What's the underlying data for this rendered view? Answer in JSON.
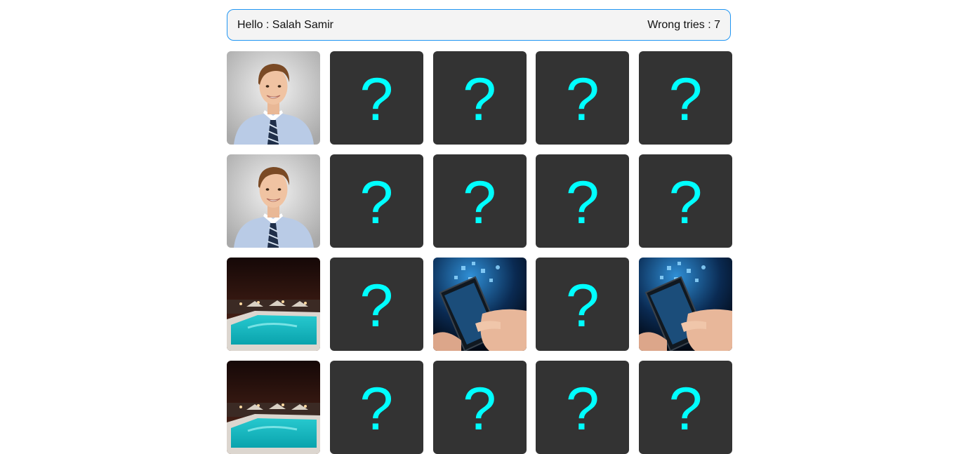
{
  "header": {
    "greeting": "Hello : Salah Samir",
    "wrong_tries": "Wrong tries : 7"
  },
  "colors": {
    "border_accent": "#2196f3",
    "card_back": "#333333",
    "question_mark": "#00ffff"
  },
  "cards": [
    {
      "state": "flipped",
      "image": "man-portrait"
    },
    {
      "state": "hidden",
      "symbol": "?"
    },
    {
      "state": "hidden",
      "symbol": "?"
    },
    {
      "state": "hidden",
      "symbol": "?"
    },
    {
      "state": "hidden",
      "symbol": "?"
    },
    {
      "state": "flipped",
      "image": "man-portrait"
    },
    {
      "state": "hidden",
      "symbol": "?"
    },
    {
      "state": "hidden",
      "symbol": "?"
    },
    {
      "state": "hidden",
      "symbol": "?"
    },
    {
      "state": "hidden",
      "symbol": "?"
    },
    {
      "state": "flipped",
      "image": "pool-night"
    },
    {
      "state": "hidden",
      "symbol": "?"
    },
    {
      "state": "flipped",
      "image": "smartphone-hands"
    },
    {
      "state": "hidden",
      "symbol": "?"
    },
    {
      "state": "flipped",
      "image": "smartphone-hands"
    },
    {
      "state": "flipped",
      "image": "pool-night"
    },
    {
      "state": "hidden",
      "symbol": "?"
    },
    {
      "state": "hidden",
      "symbol": "?"
    },
    {
      "state": "hidden",
      "symbol": "?"
    },
    {
      "state": "hidden",
      "symbol": "?"
    }
  ]
}
